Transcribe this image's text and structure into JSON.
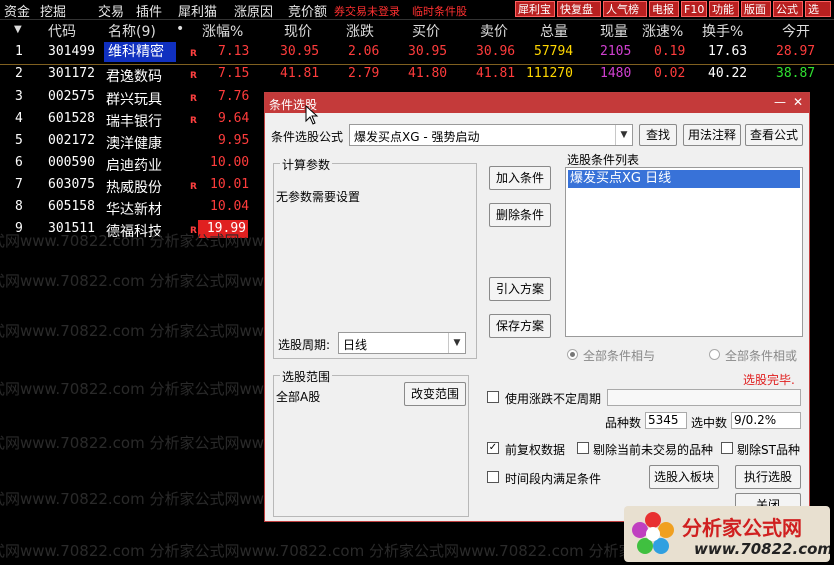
{
  "menubar": {
    "items": [
      "资金",
      "挖掘",
      "交易",
      "插件",
      "犀利猫",
      "涨原因",
      "竞价额"
    ],
    "warnings": [
      "券交易未登录",
      "临时条件股"
    ],
    "right_buttons": [
      "犀利宝",
      "快复盘",
      "人气榜",
      "电报",
      "F10",
      "功能",
      "版面",
      "公式",
      "选"
    ]
  },
  "table": {
    "headers": {
      "code": "代码",
      "name": "名称(9)",
      "dot": "•",
      "change_pct": "涨幅%",
      "price": "现价",
      "change": "涨跌",
      "bid": "买价",
      "ask": "卖价",
      "volume": "总量",
      "cur_vol": "现量",
      "speed": "涨速%",
      "turnover": "换手%",
      "open": "今开"
    },
    "sort_marker": "▼",
    "rows": [
      {
        "idx": "1",
        "code": "301499",
        "name": "维科精密",
        "r": "R",
        "pct": "7.13",
        "price": "30.95",
        "chg": "2.06",
        "bid": "30.95",
        "ask": "30.96",
        "vol": "57794",
        "cur": "2105",
        "speed": "0.19",
        "turn": "17.63",
        "open": "28.97"
      },
      {
        "idx": "2",
        "code": "301172",
        "name": "君逸数码",
        "r": "R",
        "pct": "7.15",
        "price": "41.81",
        "chg": "2.79",
        "bid": "41.80",
        "ask": "41.81",
        "vol": "111270",
        "cur": "1480",
        "speed": "0.02",
        "turn": "40.22",
        "open": "38.87"
      },
      {
        "idx": "3",
        "code": "002575",
        "name": "群兴玩具",
        "r": "R",
        "pct": "7.76"
      },
      {
        "idx": "4",
        "code": "601528",
        "name": "瑞丰银行",
        "r": "R",
        "pct": "9.64"
      },
      {
        "idx": "5",
        "code": "002172",
        "name": "澳洋健康",
        "r": "",
        "pct": "9.95"
      },
      {
        "idx": "6",
        "code": "000590",
        "name": "启迪药业",
        "r": "",
        "pct": "10.00"
      },
      {
        "idx": "7",
        "code": "603075",
        "name": "热威股份",
        "r": "R",
        "pct": "10.01"
      },
      {
        "idx": "8",
        "code": "605158",
        "name": "华达新材",
        "r": "",
        "pct": "10.04"
      },
      {
        "idx": "9",
        "code": "301511",
        "name": "德福科技",
        "r": "R",
        "pct": "19.99"
      }
    ]
  },
  "watermark": "式网www.70822.com 分析家公式网www.70822.com 分析家公式网www.70822.com 分析家公式网",
  "dialog": {
    "title": "条件选股",
    "minimize": "—",
    "close": "✕",
    "formula_label": "条件选股公式",
    "formula_value": "爆发买点XG  - 强势启动",
    "btn_find": "查找",
    "btn_usage": "用法注释",
    "btn_view": "查看公式",
    "params_group": "计算参数",
    "params_text": "无参数需要设置",
    "btn_add": "加入条件",
    "btn_delete": "删除条件",
    "btn_import": "引入方案",
    "btn_save": "保存方案",
    "list_label": "选股条件列表",
    "list_items": [
      "爆发买点XG  日线"
    ],
    "period_label": "选股周期:",
    "period_value": "日线",
    "radio_and": "全部条件相与",
    "radio_or": "全部条件相或",
    "status": "选股完毕.",
    "range_group": "选股范围",
    "range_value": "全部A股",
    "btn_change_range": "改变范围",
    "chk_unfixed": "使用涨跌不定周期",
    "count_label": "品种数",
    "count_value": "5345",
    "selected_label": "选中数",
    "selected_value": "9/0.2%",
    "chk_fq": "前复权数据",
    "chk_untraded": "剔除当前未交易的品种",
    "chk_st": "剔除ST品种",
    "chk_timerange": "时间段内满足条件",
    "btn_to_block": "选股入板块",
    "btn_execute": "执行选股",
    "btn_close": "关闭"
  },
  "logo": {
    "name": "分析家公式网",
    "url": "www.70822.com"
  },
  "colors": {
    "up": "#ff3c3c",
    "vol": "#ffd700",
    "curvol": "#d040d0",
    "dialog_title": "#c43a3a",
    "selected": "#3872d8"
  }
}
